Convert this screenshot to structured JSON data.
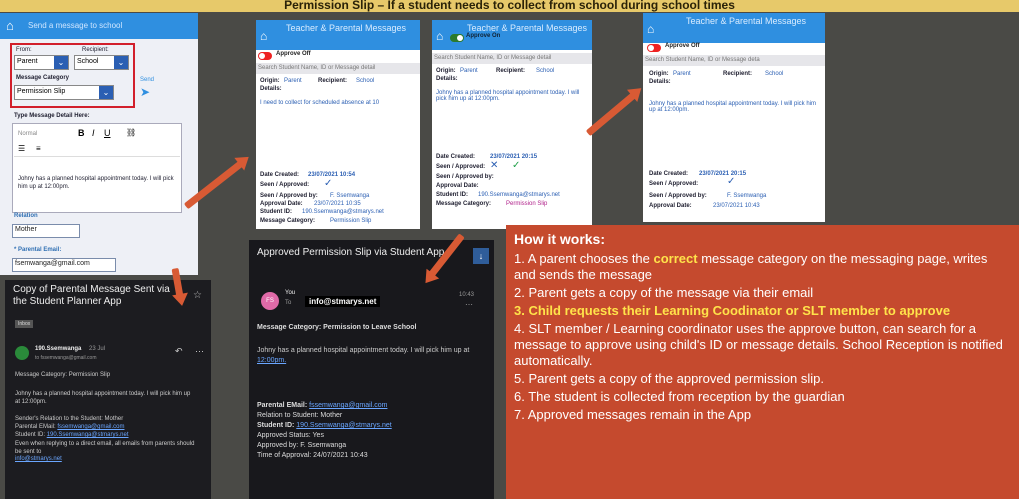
{
  "header": {
    "title": "Permission Slip – If a student needs to collect from school during school times"
  },
  "form": {
    "title": "Send a message to school",
    "from_label": "From:",
    "from_value": "Parent",
    "recipient_label": "Recipient:",
    "recipient_value": "School",
    "category_label": "Message Category",
    "category_value": "Permission Slip",
    "send_label": "Send",
    "detail_label": "Type Message Detail Here:",
    "rte_font": "Normal",
    "message": "Johny has a planned hospital appointment today. I will pick him up at 12:00pm.",
    "relation_label": "Relation",
    "relation_value": "Mother",
    "email_label": "* Parental Email:",
    "email_value": "fsemwanga@gmail.com"
  },
  "cards": [
    {
      "title": "Teacher & Parental Messages",
      "toggle": "Approve Off",
      "search": "Search Student Name, ID or Message detail",
      "origin_label": "Origin:",
      "origin": "Parent",
      "recipient_label": "Recipient:",
      "recipient": "School",
      "details_label": "Details:",
      "details": "I need to collect for scheduled absence at 10",
      "date_label": "Date Created:",
      "date": "23/07/2021 10:54",
      "seen_label": "Seen / Approved:",
      "seenby_label": "Seen / Approved by:",
      "seenby": "F. Ssemwanga",
      "approvaldate_label": "Approval Date:",
      "approvaldate": "23/07/2021 10:35",
      "studentid_label": "Student ID:",
      "studentid": "190.Ssemwanga@stmarys.net",
      "category_label": "Message Category:",
      "category": "Permission Slip"
    },
    {
      "title": "Teacher & Parental Messages",
      "toggle": "Approve On",
      "search": "Search Student Name, ID or Message detail",
      "origin_label": "Origin:",
      "origin": "Parent",
      "recipient_label": "Recipient:",
      "recipient": "School",
      "details_label": "Details:",
      "details": "Johny has a planned hospital appointment today. I will pick him up at 12:00pm.",
      "date_label": "Date Created:",
      "date": "23/07/2021 20:15",
      "seen_label": "Seen / Approved:",
      "seenby_label": "Seen / Approved by:",
      "approvaldate_label": "Approval Date:",
      "studentid_label": "Student ID:",
      "studentid": "190.Ssemwanga@stmarys.net",
      "category_label": "Message Category:",
      "category": "Permission Slip"
    },
    {
      "title": "Teacher & Parental Messages",
      "toggle": "Approve Off",
      "search": "Search Student Name, ID or Message deta",
      "origin_label": "Origin:",
      "origin": "Parent",
      "recipient_label": "Recipient:",
      "recipient": "School",
      "details_label": "Details:",
      "details": "Johny has a planned hospital appointment today. I will pick him up at 12:00pm.",
      "date_label": "Date Created:",
      "date": "23/07/2021 20:15",
      "seen_label": "Seen / Approved:",
      "seenby_label": "Seen / Approved by:",
      "seenby": "F. Ssemwanga",
      "approvaldate_label": "Approval Date:",
      "approvaldate": "23/07/2021 10:43"
    }
  ],
  "email1": {
    "subject": "Copy of Parental Message Sent via the Student Planner App",
    "tag": "Inbox",
    "sender": "190.Ssemwanga",
    "sender_time": "23 Jul",
    "sender_to": "to fssemwanga@gmail.com",
    "category_line": "Message Category: Permission Slip",
    "body": "Johny has a planned hospital appointment today. I will pick him up at 12:00pm.",
    "relation_line": "Sender's Relation to the Student: Mother",
    "email_line_label": "Parental EMail:",
    "email_line_value": "fssemwanga@gmail.com",
    "id_line_label": "Student ID:",
    "id_line_value": "190.Ssemwanga@stmarys.net",
    "note": "Even when replying to a direct email, all emails from parents should be sent to",
    "note_addr": "info@stmarys.net"
  },
  "email2": {
    "subject": "Approved Permission Slip via Student App",
    "avatar": "FS",
    "from": "You",
    "to_label": "To",
    "to": "info@stmarys.net",
    "time": "10:43",
    "category_line": "Message Category: Permission to Leave School",
    "body": "Johny has a planned hospital appointment today. I will pick him up at",
    "body_time": "12:00pm.",
    "email_label": "Parental EMail:",
    "email_value": "fssemwanga@gmail.com",
    "relation": "Relation to Student: Mother",
    "id_label": "Student ID:",
    "id_value": "190.Ssemwanga@stmarys.net",
    "status": "Approved Status: Yes",
    "by": "Approved by: F. Ssemwanga",
    "time_line": "Time of Approval: 24/07/2021 10:43"
  },
  "how": {
    "title": "How it works:",
    "steps": [
      {
        "n": "1.",
        "pre": "A parent chooses the ",
        "em": "correct",
        "post": " message category on the messaging page, writes and sends the message"
      },
      {
        "n": "2.",
        "text": "Parent gets a copy of the message via their email"
      },
      {
        "n": "3.",
        "text": "Child requests their Learning Coodinator or SLT member to approve"
      },
      {
        "n": "4.",
        "text": "SLT member / Learning coordinator uses the approve button, can search for a message to approve using child's ID or message details.  School Reception is notified automatically."
      },
      {
        "n": "5.",
        "text": "Parent gets a copy of the approved permission slip."
      },
      {
        "n": "6.",
        "text": "The student is collected from reception by the guardian"
      },
      {
        "n": "7.",
        "text": "Approved messages remain in the App"
      }
    ]
  },
  "colors": {
    "accent": "#2f8fe0",
    "how_bg": "#c54a2e",
    "highlight": "#ffe34a",
    "header": "#e7c96a"
  }
}
